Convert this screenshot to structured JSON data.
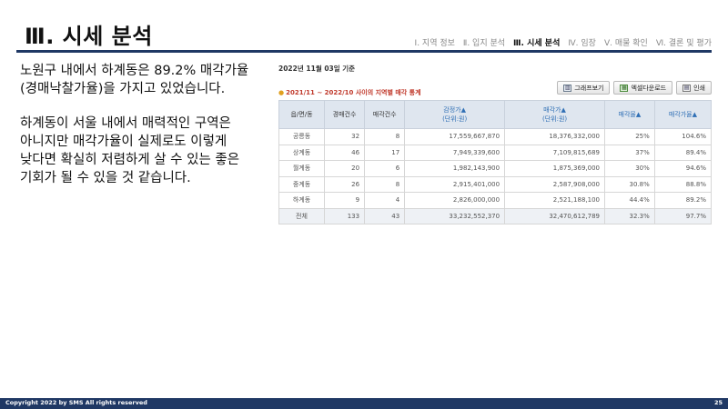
{
  "header": {
    "title": "Ⅲ. 시세 분석",
    "nav": [
      {
        "label": "Ⅰ. 지역 정보",
        "active": false
      },
      {
        "label": "Ⅱ. 입지 분석",
        "active": false
      },
      {
        "label": "Ⅲ. 시세 분석",
        "active": true
      },
      {
        "label": "Ⅳ. 임장",
        "active": false
      },
      {
        "label": "Ⅴ. 매물 확인",
        "active": false
      },
      {
        "label": "Ⅵ. 결론 및 평가",
        "active": false
      }
    ]
  },
  "body": {
    "paragraph1": "노원구 내에서 하계동은 89.2% 매각가율(경매낙찰가율)을 가지고 있었습니다.",
    "paragraph2": "하계동이 서울 내에서 매력적인 구역은 아니지만 매각가율이 실제로도 이렇게 낮다면 확실히 저렴하게 살 수 있는 좋은 기회가 될 수 있을 것 같습니다."
  },
  "report": {
    "date": "2022년 11월 03일 기준",
    "subtitle": "2021/11 ~ 2022/10 사이의 지역별 매각 통계",
    "buttons": {
      "graph": "그래프보기",
      "excel": "엑셀다운로드",
      "print": "인쇄"
    },
    "columns": [
      {
        "label": "읍/면/동",
        "sub": "",
        "sortable": false
      },
      {
        "label": "경매건수",
        "sub": "",
        "sortable": false
      },
      {
        "label": "매각건수",
        "sub": "",
        "sortable": false
      },
      {
        "label": "감정가▲",
        "sub": "(단위:원)",
        "sortable": true
      },
      {
        "label": "매각가▲",
        "sub": "(단위:원)",
        "sortable": true
      },
      {
        "label": "매각율▲",
        "sub": "",
        "sortable": true
      },
      {
        "label": "매각가율▲",
        "sub": "",
        "sortable": true
      }
    ],
    "rows": [
      [
        "공릉동",
        "32",
        "8",
        "17,559,667,870",
        "18,376,332,000",
        "25%",
        "104.6%"
      ],
      [
        "상계동",
        "46",
        "17",
        "7,949,339,600",
        "7,109,815,689",
        "37%",
        "89.4%"
      ],
      [
        "월계동",
        "20",
        "6",
        "1,982,143,900",
        "1,875,369,000",
        "30%",
        "94.6%"
      ],
      [
        "중계동",
        "26",
        "8",
        "2,915,401,000",
        "2,587,908,000",
        "30.8%",
        "88.8%"
      ],
      [
        "하계동",
        "9",
        "4",
        "2,826,000,000",
        "2,521,188,100",
        "44.4%",
        "89.2%"
      ]
    ],
    "total": [
      "전체",
      "133",
      "43",
      "33,232,552,370",
      "32,470,612,789",
      "32.3%",
      "97.7%"
    ]
  },
  "footer": {
    "copyright": "Copyright 2022 by SMS All rights reserved",
    "page": "25"
  },
  "colors": {
    "accent": "#1f3864",
    "table_header": "#dfe6ef",
    "sort_link": "#2f6fb5",
    "subtitle": "#c0392b"
  }
}
